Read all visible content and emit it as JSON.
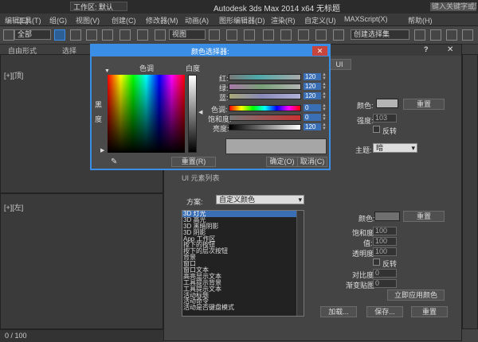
{
  "titlebar": {
    "workspace": "工作区: 默认",
    "title": "Autodesk 3ds Max  2014 x64      无标题",
    "search_placeholder": "键入关键字或短语"
  },
  "menu": [
    "编辑(E)",
    "工具(T)",
    "组(G)",
    "视图(V)",
    "创建(C)",
    "修改器(M)",
    "动画(A)",
    "图形编辑器(D)",
    "渲染(R)",
    "自定义(U)",
    "MAXScript(X)",
    "帮助(H)"
  ],
  "toolbar": {
    "filter_select": "全部",
    "view_select": "视图",
    "selection_set": "创建选择集"
  },
  "ribbon": [
    "自由形式",
    "选择"
  ],
  "viewports": {
    "label_top": "[+][顶]",
    "label_left": "[+][左]"
  },
  "timeline": {
    "frame": "0 / 100"
  },
  "preferences": {
    "tab": "UI",
    "color_label": "颜色:",
    "reset_label": "重置",
    "intensity_label": "强度:",
    "intensity_value": "103",
    "invert_label": "反转",
    "theme_label": "主题:",
    "theme_value": "暗",
    "scheme_label": "方案:",
    "scheme_value": "自定义颜色",
    "partial_header": "UI 元素列表",
    "list_items": [
      "3D 灯光",
      "3D 高光",
      "3D 黑暗阴影",
      "3D 阴影",
      "App 工作区",
      "按下的按钮",
      "按下的层次按钮",
      "背景",
      "窗口",
      "窗口文本",
      "高亮显示文本",
      "工具提示背景",
      "工具提示文本",
      "活动标题",
      "活动命令",
      "活动是否键盘模式"
    ],
    "color2_label": "颜色:",
    "reset2_label": "重置",
    "saturation_label": "饱和度:",
    "saturation_value": "100",
    "value_label": "值:",
    "value_value": "100",
    "transparency_label": "透明度:",
    "transparency_value": "100",
    "invert2_label": "反转",
    "contrast_label": "对比度:",
    "contrast_value": "0",
    "gradient_label": "渐变贴图:",
    "gradient_value": "0",
    "apply_button": "立即应用颜色",
    "load_button": "加载...",
    "save_button": "保存...",
    "reset3_button": "重置",
    "colors": {
      "swatch1": "#b4b4b4",
      "swatch2": "#6f6f6f"
    }
  },
  "color_picker": {
    "title": "颜色选择器:",
    "hue_label": "色调",
    "whiteness_label": "白度",
    "blackness_label": "黑\n度",
    "red_label": "红:",
    "green_label": "绿:",
    "blue_label": "蓝:",
    "hue2_label": "色调:",
    "saturation_label": "饱和度:",
    "brightness_label": "亮度:",
    "red": "120",
    "green": "120",
    "blue": "120",
    "hue": "0",
    "saturation": "0",
    "brightness": "120",
    "reset_button": "重置(R)",
    "ok_button": "确定(O)",
    "cancel_button": "取消(C)",
    "accent": "#3a8ee6",
    "preview_color": "#a6a6a6"
  }
}
